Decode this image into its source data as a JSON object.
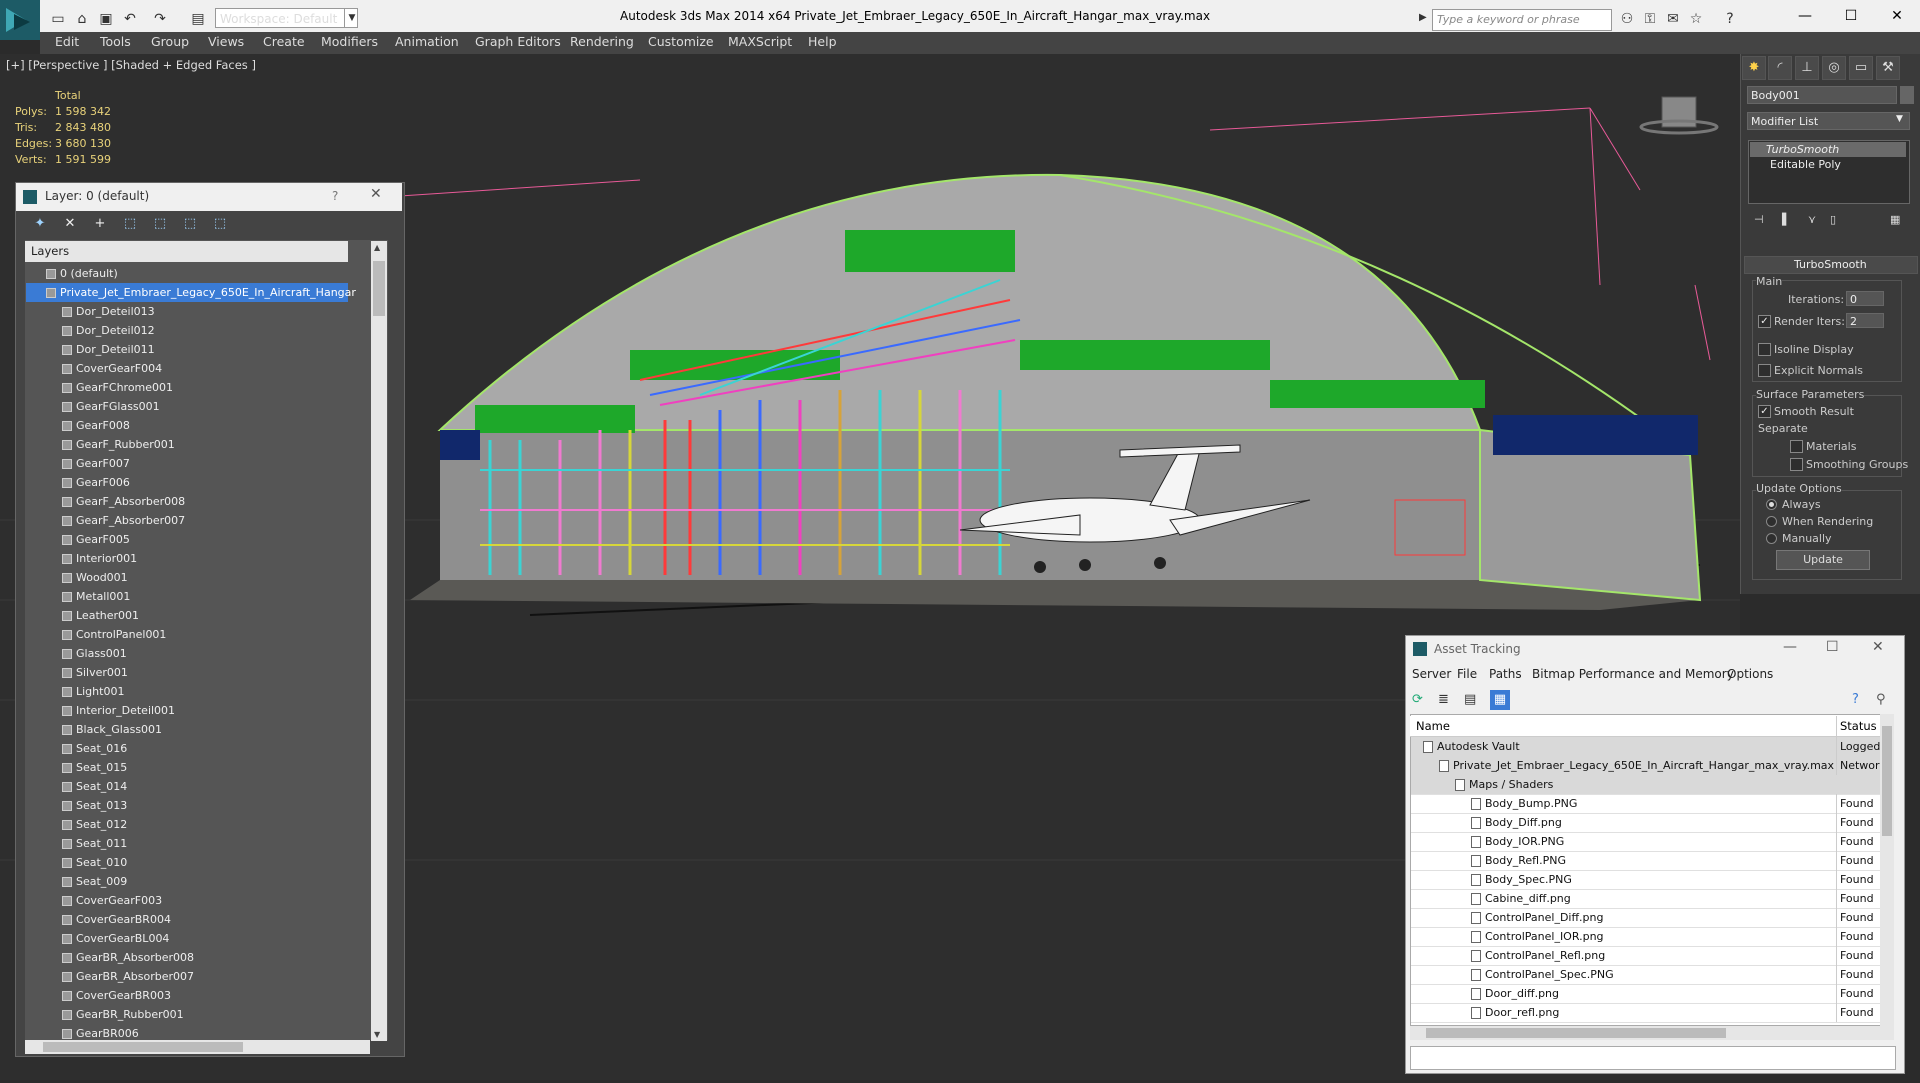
{
  "app": {
    "title": "Autodesk 3ds Max  2014 x64      Private_Jet_Embraer_Legacy_650E_In_Aircraft_Hangar_max_vray.max",
    "workspace": "Workspace: Default",
    "search_placeholder": "Type a keyword or phrase",
    "menu": [
      "Edit",
      "Tools",
      "Group",
      "Views",
      "Create",
      "Modifiers",
      "Animation",
      "Graph Editors",
      "Rendering",
      "Customize",
      "MAXScript",
      "Help"
    ]
  },
  "viewport": {
    "label": "[+] [Perspective ] [Shaded + Edged Faces ]",
    "stats_header": "Total",
    "stats": [
      {
        "label": "Polys:",
        "value": "1 598 342"
      },
      {
        "label": "Tris:",
        "value": "2 843 480"
      },
      {
        "label": "Edges:",
        "value": "3 680 130"
      },
      {
        "label": "Verts:",
        "value": "1 591 599"
      }
    ],
    "viewcube": "FRONT"
  },
  "command_panel": {
    "object_name": "Body001",
    "modifier_list": "Modifier List",
    "stack": [
      "TurboSmooth",
      "Editable Poly"
    ],
    "rollout_title": "TurboSmooth",
    "main_label": "Main",
    "iterations_label": "Iterations:",
    "iterations_value": "0",
    "render_iters_label": "Render Iters:",
    "render_iters_value": "2",
    "isoline_label": "Isoline Display",
    "explicit_label": "Explicit Normals",
    "surface_label": "Surface Parameters",
    "smooth_label": "Smooth Result",
    "separate_label": "Separate",
    "materials_label": "Materials",
    "smoothing_label": "Smoothing Groups",
    "update_options_label": "Update Options",
    "always_label": "Always",
    "when_rendering_label": "When Rendering",
    "manually_label": "Manually",
    "update_button": "Update"
  },
  "layer_explorer": {
    "title": "Layer: 0 (default)",
    "help": "?",
    "header": "Layers",
    "rows": [
      {
        "name": "0 (default)",
        "indent": 1,
        "selected": false
      },
      {
        "name": "Private_Jet_Embraer_Legacy_650E_In_Aircraft_Hangar",
        "indent": 1,
        "selected": true
      },
      {
        "name": "Dor_Deteil013",
        "indent": 2
      },
      {
        "name": "Dor_Deteil012",
        "indent": 2
      },
      {
        "name": "Dor_Deteil011",
        "indent": 2
      },
      {
        "name": "CoverGearF004",
        "indent": 2
      },
      {
        "name": "GearFChrome001",
        "indent": 2
      },
      {
        "name": "GearFGlass001",
        "indent": 2
      },
      {
        "name": "GearF008",
        "indent": 2
      },
      {
        "name": "GearF_Rubber001",
        "indent": 2
      },
      {
        "name": "GearF007",
        "indent": 2
      },
      {
        "name": "GearF006",
        "indent": 2
      },
      {
        "name": "GearF_Absorber008",
        "indent": 2
      },
      {
        "name": "GearF_Absorber007",
        "indent": 2
      },
      {
        "name": "GearF005",
        "indent": 2
      },
      {
        "name": "Interior001",
        "indent": 2
      },
      {
        "name": "Wood001",
        "indent": 2
      },
      {
        "name": "Metall001",
        "indent": 2
      },
      {
        "name": "Leather001",
        "indent": 2
      },
      {
        "name": "ControlPanel001",
        "indent": 2
      },
      {
        "name": "Glass001",
        "indent": 2
      },
      {
        "name": "Silver001",
        "indent": 2
      },
      {
        "name": "Light001",
        "indent": 2
      },
      {
        "name": "Interior_Deteil001",
        "indent": 2
      },
      {
        "name": "Black_Glass001",
        "indent": 2
      },
      {
        "name": "Seat_016",
        "indent": 2
      },
      {
        "name": "Seat_015",
        "indent": 2
      },
      {
        "name": "Seat_014",
        "indent": 2
      },
      {
        "name": "Seat_013",
        "indent": 2
      },
      {
        "name": "Seat_012",
        "indent": 2
      },
      {
        "name": "Seat_011",
        "indent": 2
      },
      {
        "name": "Seat_010",
        "indent": 2
      },
      {
        "name": "Seat_009",
        "indent": 2
      },
      {
        "name": "CoverGearF003",
        "indent": 2
      },
      {
        "name": "CoverGearBR004",
        "indent": 2
      },
      {
        "name": "CoverGearBL004",
        "indent": 2
      },
      {
        "name": "GearBR_Absorber008",
        "indent": 2
      },
      {
        "name": "GearBR_Absorber007",
        "indent": 2
      },
      {
        "name": "CoverGearBR003",
        "indent": 2
      },
      {
        "name": "GearBR_Rubber001",
        "indent": 2
      },
      {
        "name": "GearBR006",
        "indent": 2
      }
    ]
  },
  "asset_tracking": {
    "title": "Asset Tracking",
    "menu": [
      "Server",
      "File",
      "Paths",
      "Bitmap Performance and Memory",
      "Options"
    ],
    "col_name": "Name",
    "col_status": "Status",
    "rows": [
      {
        "name": "Autodesk Vault",
        "status": "Logged",
        "indent": 1,
        "grey": true
      },
      {
        "name": "Private_Jet_Embraer_Legacy_650E_In_Aircraft_Hangar_max_vray.max",
        "status": "Network",
        "indent": 2,
        "grey": true
      },
      {
        "name": "Maps / Shaders",
        "status": "",
        "indent": 3,
        "grey": true
      },
      {
        "name": "Body_Bump.PNG",
        "status": "Found",
        "indent": 4
      },
      {
        "name": "Body_Diff.png",
        "status": "Found",
        "indent": 4
      },
      {
        "name": "Body_IOR.PNG",
        "status": "Found",
        "indent": 4
      },
      {
        "name": "Body_Refl.PNG",
        "status": "Found",
        "indent": 4
      },
      {
        "name": "Body_Spec.PNG",
        "status": "Found",
        "indent": 4
      },
      {
        "name": "Cabine_diff.png",
        "status": "Found",
        "indent": 4
      },
      {
        "name": "ControlPanel_Diff.png",
        "status": "Found",
        "indent": 4
      },
      {
        "name": "ControlPanel_IOR.png",
        "status": "Found",
        "indent": 4
      },
      {
        "name": "ControlPanel_Refl.png",
        "status": "Found",
        "indent": 4
      },
      {
        "name": "ControlPanel_Spec.PNG",
        "status": "Found",
        "indent": 4
      },
      {
        "name": "Door_diff.png",
        "status": "Found",
        "indent": 4
      },
      {
        "name": "Door_refl.png",
        "status": "Found",
        "indent": 4
      }
    ]
  }
}
